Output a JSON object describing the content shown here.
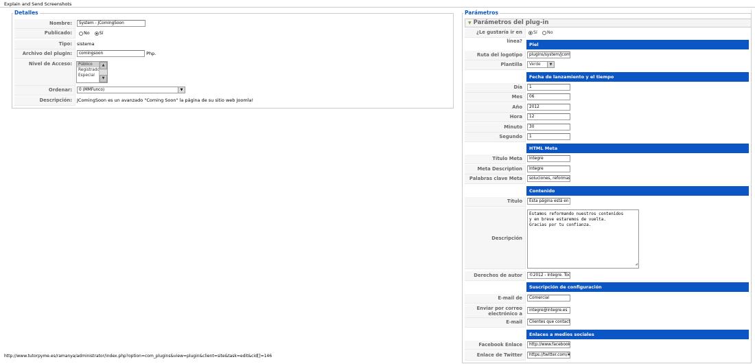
{
  "window": {
    "title": "Explain and Send Screenshots"
  },
  "details": {
    "legend": "Detalles",
    "nombre_label": "Nombre:",
    "nombre_value": "System - JComingSoon",
    "publicado_label": "Publicado:",
    "publicado_no": "No",
    "publicado_si": "Sí",
    "tipo_label": "Tipo:",
    "tipo_value": "sistema",
    "archivo_label": "Archivo del plugin:",
    "archivo_value": "comingsoon",
    "archivo_ext": "Php.",
    "nivel_label": "Nivel de Acceso:",
    "nivel_options": [
      "Público",
      "Registrado",
      "Especial"
    ],
    "ordenar_label": "Ordenar:",
    "ordenar_value": "0 (MMFunco)",
    "descripcion_label": "Descripción:",
    "descripcion_value": "JComingSoon es un avanzado \"Coming Soon\" la página de su sitio web Joomla!"
  },
  "params": {
    "legend": "Parámetros",
    "pane_title": "Parámetros del plug-in",
    "online_label": "¿Le gustaría ir en línea?",
    "online_si": "Sí",
    "online_no": "No",
    "sec_piel": "Piel",
    "ruta_label": "Ruta del logotipo",
    "ruta_value": "plugins/system/jcomin",
    "plantilla_label": "Plantilla",
    "plantilla_value": "Verde",
    "sec_fecha": "Fecha de lanzamiento y el tiempo",
    "dia_label": "Día",
    "dia_value": "1",
    "mes_label": "Mes",
    "mes_value": "06",
    "anio_label": "Año",
    "anio_value": "2012",
    "hora_label": "Hora",
    "hora_value": "12",
    "minuto_label": "Minuto",
    "minuto_value": "30",
    "segundo_label": "Segundo",
    "segundo_value": "1",
    "sec_meta": "HTML Meta",
    "titulo_meta_label": "Título Meta",
    "titulo_meta_value": "Integre",
    "meta_desc_label": "Meta Description",
    "meta_desc_value": "Integre",
    "palabras_label": "Palabras clave Meta",
    "palabras_value": "soluciones, reformas, r",
    "sec_contenido": "Contenido",
    "titulo_label": "Título",
    "titulo_value": "Esta página está en co",
    "descripcion_label": "Descripción",
    "descripcion_value": "Estamos reformando nuestros contenidos\ny en breve estaremos de vuelta.\nGracias por tu confianza.",
    "derechos_label": "Derechos de autor",
    "derechos_value": "©2012 - Integre. Todo",
    "sec_suscripcion": "Suscripción de configuración",
    "email_de_label": "E-mail de",
    "email_de_value": "Comercial",
    "enviar_label": "Enviar por correo electrónico a",
    "enviar_value": "integre@integre.es",
    "email_label": "E-mail",
    "email_value": "Clientes que contactan",
    "sec_sociales": "Enlaces a medios sociales",
    "facebook_label": "Facebook Enlace",
    "facebook_value": "http://www.facebook.co",
    "twitter_label": "Enlace de Twitter",
    "twitter_value": "https://twitter.com/#!/S"
  },
  "status": {
    "url": "http://www.tutorpyme.es/ramanya/administrator/index.php?option=com_plugins&view=plugin&client=site&task=edit&cid[]=146"
  }
}
